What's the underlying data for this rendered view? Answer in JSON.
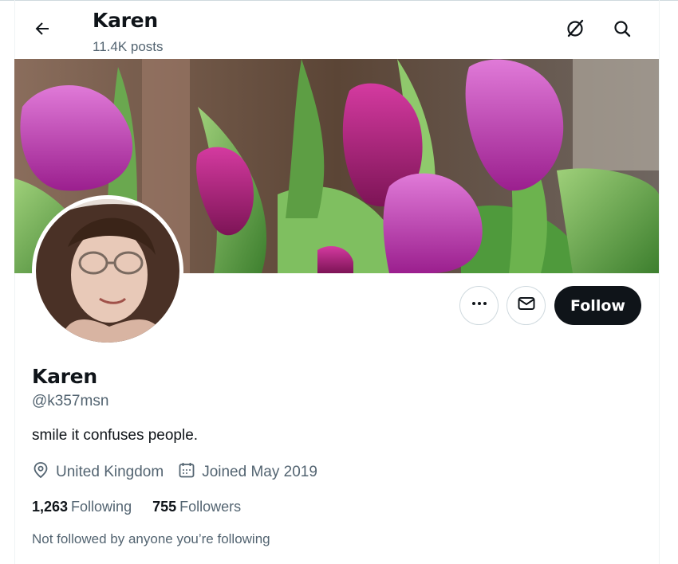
{
  "header": {
    "back_icon": "arrow-left-icon",
    "display_name": "Karen",
    "post_count": "11.4K posts",
    "grok_icon": "grok-icon",
    "search_icon": "search-icon"
  },
  "profile": {
    "display_name": "Karen",
    "handle": "@k357msn",
    "bio": "smile it confuses people.",
    "location": "United Kingdom",
    "location_icon": "location-pin-icon",
    "joined": "Joined May 2019",
    "joined_icon": "calendar-icon",
    "following_count": "1,263",
    "following_label": "Following",
    "followers_count": "755",
    "followers_label": "Followers",
    "followed_by_note": "Not followed by anyone you’re following"
  },
  "actions": {
    "more_icon": "more-dots-icon",
    "message_icon": "envelope-icon",
    "follow_label": "Follow"
  },
  "colors": {
    "text_primary": "#0f1419",
    "text_secondary": "#536471",
    "border": "#cfd9de",
    "follow_bg": "#0f1419"
  }
}
